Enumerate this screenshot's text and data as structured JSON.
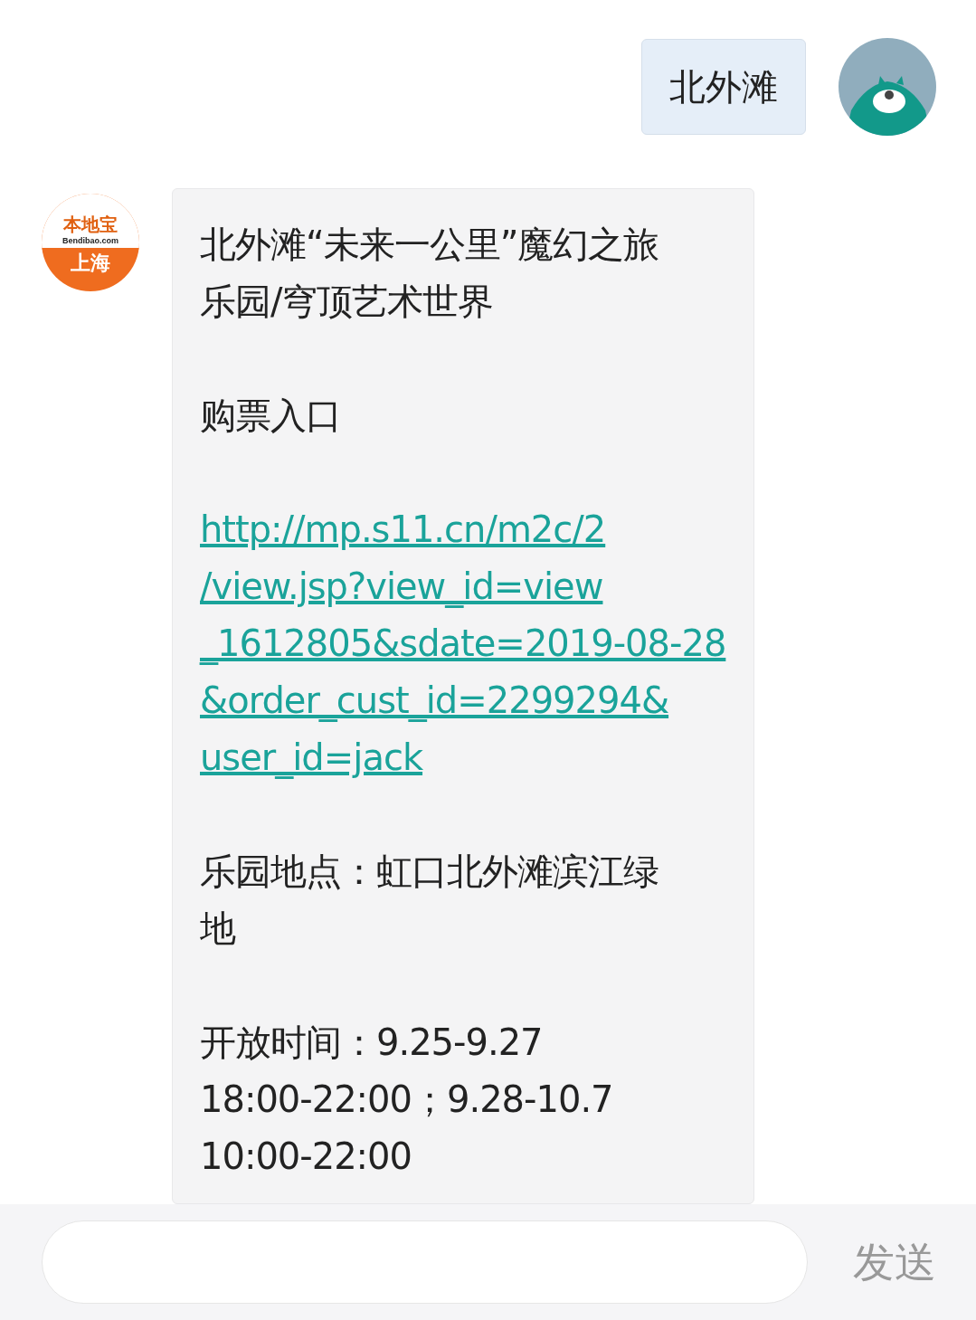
{
  "messages": [
    {
      "kind": "user",
      "text": "北外滩"
    },
    {
      "kind": "bot",
      "avatar": {
        "logo_top": "本地宝",
        "logo_site": "Bendibao.com",
        "logo_city": "上海"
      },
      "paragraphs": [
        {
          "kind": "text",
          "lines": [
            "北外滩“未来一公里”魔幻之旅",
            "乐园/穹顶艺术世界"
          ]
        },
        {
          "kind": "text",
          "lines": [
            "购票入口"
          ]
        },
        {
          "kind": "link",
          "lines": [
            "http://mp.s11.cn/m2c/2",
            "/view.jsp?view_id=view",
            "_1612805&sdate=2019-08-28",
            "&order_cust_id=2299294&",
            "user_id=jack"
          ]
        },
        {
          "kind": "text",
          "lines": [
            "乐园地点：虹口北外滩滨江绿",
            "地"
          ]
        },
        {
          "kind": "text",
          "lines": [
            "开放时间：9.25-9.27",
            "18:00-22:00；9.28-10.7",
            "10:00-22:00"
          ]
        }
      ]
    }
  ],
  "composer": {
    "send": "发送"
  }
}
